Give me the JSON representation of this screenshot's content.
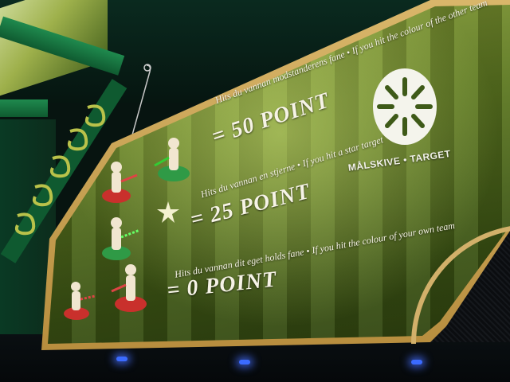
{
  "sign": {
    "rows": [
      {
        "caption": "Hits du vannan modstanderens fane • If you hit the colour of the other team",
        "points": "= 50 POINT"
      },
      {
        "caption": "Hits du vannan en stjerne • If you hit a star target",
        "points": "= 25 POINT"
      },
      {
        "caption": "Hits du vannan dit eget holds fane • If you hit the colour of your own team",
        "points": "= 0 POINT"
      }
    ],
    "target_label": "MÅLSKIVE • TARGET"
  },
  "colors": {
    "panel_green": "#5f7a22",
    "frame_gold": "#d2b06a",
    "team_red": "#c9302c",
    "team_green": "#2f9a46"
  },
  "icons": [
    "target-icon",
    "star-icon",
    "gun-figure-icon"
  ]
}
